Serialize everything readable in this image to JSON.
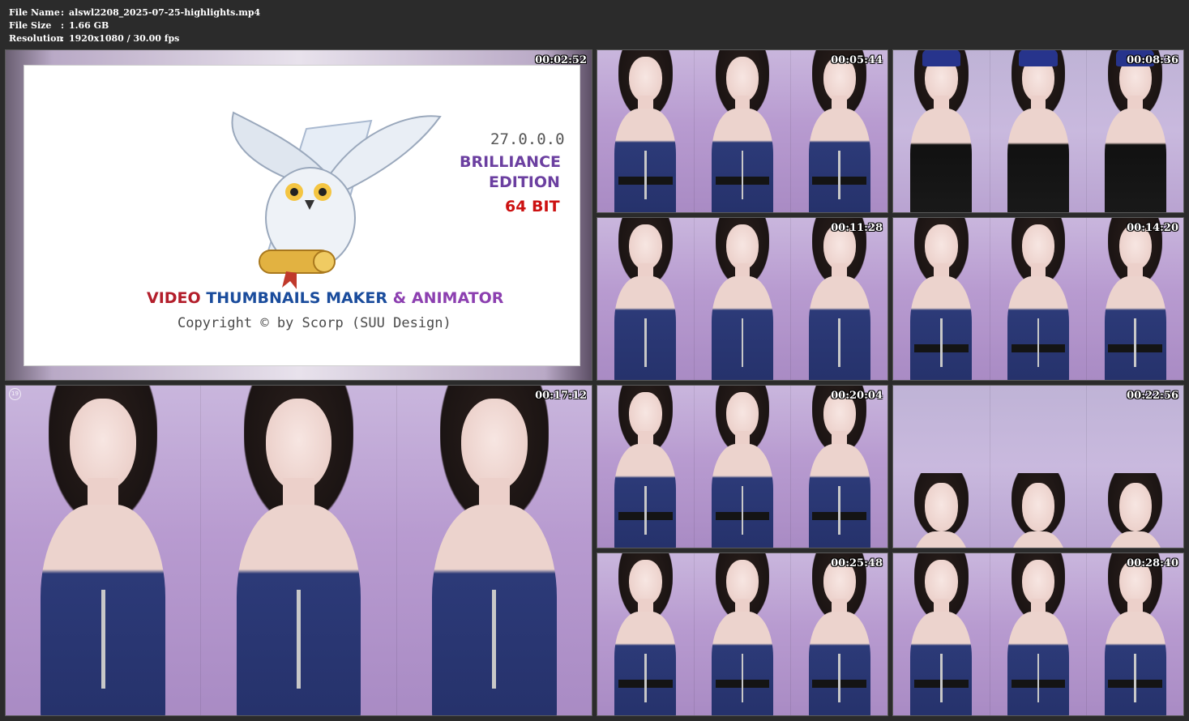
{
  "header": {
    "file_name_label": "File Name",
    "file_name": "alswl2208_2025-07-25-highlights.mp4",
    "file_size_label": "File Size",
    "file_size": "1.66 GB",
    "resolution_label": "Resolution",
    "resolution": "1920x1080 / 30.00 fps",
    "separator": ":"
  },
  "splash": {
    "version": "27.0.0.0",
    "edition_line1": "BRILLIANCE",
    "edition_line2": "EDITION",
    "bits": "64 BIT",
    "title_video": "VIDEO",
    "title_thumbnails": "THUMBNAILS MAKER",
    "title_amp": "&",
    "title_animator": "ANIMATOR",
    "copyright": "Copyright © by Scorp (SUU Design)",
    "timestamp": "00:02:52"
  },
  "thumbnails": [
    {
      "timestamp": "00:05:44",
      "index": ""
    },
    {
      "timestamp": "00:08:36",
      "index": ""
    },
    {
      "timestamp": "00:11:28",
      "index": ""
    },
    {
      "timestamp": "00:14:20",
      "index": ""
    },
    {
      "timestamp": "00:17:12",
      "index": "19"
    },
    {
      "timestamp": "00:20:04",
      "index": ""
    },
    {
      "timestamp": "00:22:56",
      "index": ""
    },
    {
      "timestamp": "00:25:48",
      "index": ""
    },
    {
      "timestamp": "00:28:40",
      "index": ""
    }
  ],
  "colors": {
    "background": "#2b2b2b",
    "uniform": "#2c3a78",
    "backdrop": "#b89bd0"
  }
}
